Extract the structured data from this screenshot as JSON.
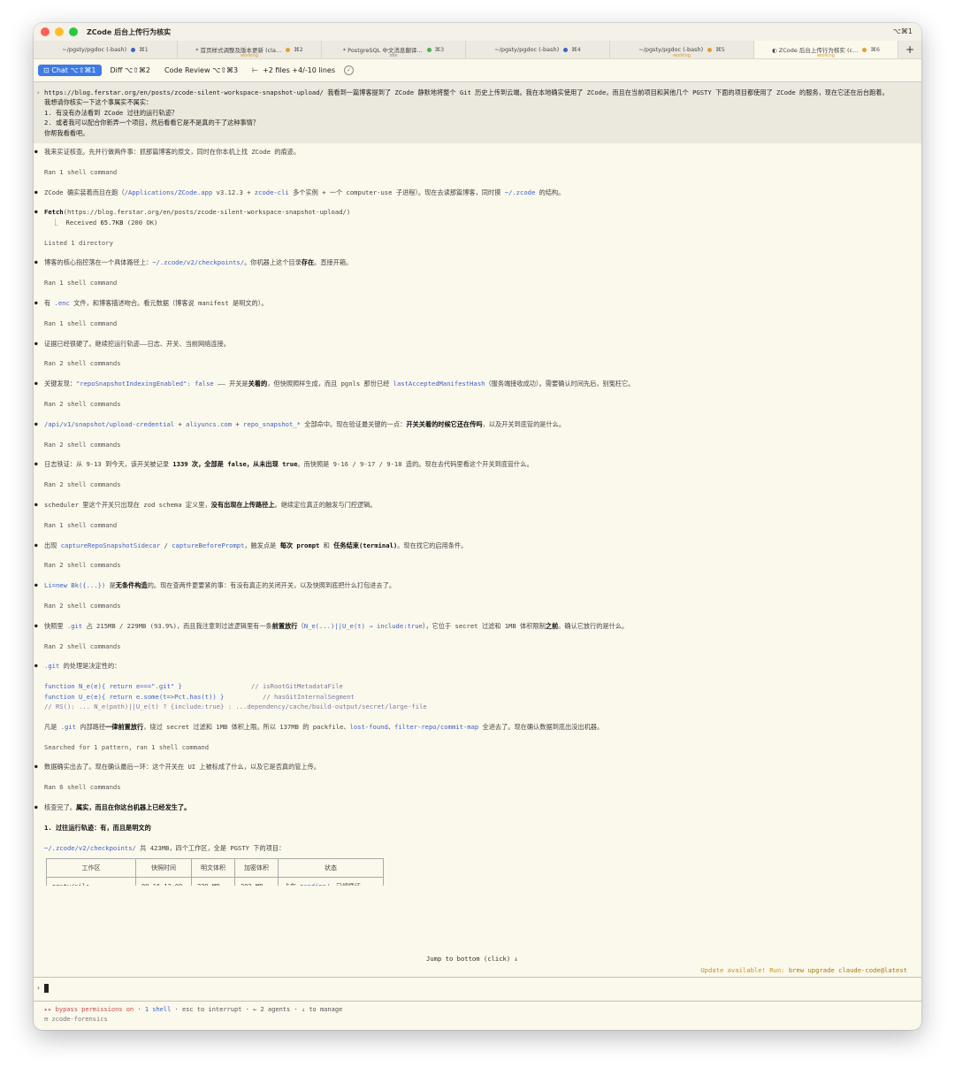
{
  "window": {
    "title": "ZCode 后台上传行为核实",
    "shortcut": "⌥⌘1"
  },
  "tabs": [
    {
      "label": "~/pgsty/pgdoc (-bash)",
      "key": "⌘1",
      "dot": "#3e62c8",
      "status": ""
    },
    {
      "label": "* 首页样式调整及版本更新 (cla...",
      "key": "⌘2",
      "dot": "#e0a030",
      "status": "working"
    },
    {
      "label": "* PostgreSQL 中文消息翻译...",
      "key": "⌘3",
      "dot": "#4caf50",
      "status": "idle"
    },
    {
      "label": "~/pgsty/pgdoc (-bash)",
      "key": "⌘4",
      "dot": "#3e62c8",
      "status": ""
    },
    {
      "label": "~/pgsty/pgdoc (-bash)",
      "key": "⌘5",
      "dot": "#e0a030",
      "status": "working"
    },
    {
      "label": "◐ ZCode 后台上传行为核实 (c...",
      "key": "⌘6",
      "dot": "#e0a030",
      "status": "working"
    }
  ],
  "toolbar": {
    "chat": "Chat ⌥⇧⌘1",
    "diff": "Diff ⌥⇧⌘2",
    "review": "Code Review ⌥⇧⌘3",
    "files": "+2 files +4/-10 lines"
  },
  "user_message": [
    "https://blog.ferstar.org/en/posts/zcode-silent-workspace-snapshot-upload/ 我看到一篇博客提到了 ZCode 静默地将整个 Git 历史上传到云端。我在本地确实使用了 ZCode，而且在当前项目和其他几个 PGSTY 下面的项目都使用了 ZCode 的服务，现在它还在后台跑着。",
    "",
    "我想请你核实一下这个事属实不属实：",
    "",
    "1. 有没有办法看到 ZCode 过往的运行轨迹？",
    "2. 或者我可以配合你新弄一个项目，然后看看它是不是真的干了这种事情？",
    "",
    "你帮我看看吧。"
  ],
  "ran": {
    "r1": "Ran 1 shell command",
    "r2": "Ran 2 shell commands",
    "r6": "Ran 6 shell commands",
    "listed": "Listed 1 directory",
    "searched": "Searched for 1 pattern, ran 1 shell command"
  },
  "msg": {
    "m1": "我来实证核查。先并行做两件事：抓那篇博客的原文，同时在你本机上找 ZCode 的痕迹。",
    "m2a": "ZCode 确实装着而且在跑（",
    "m2b": "/Applications/ZCode.app",
    "m2c": " v3.12.3 + ",
    "m2d": "zcode-cli",
    "m2e": " 多个实例 + 一个 computer-use 子进程）。现在去读那篇博客，同时摸 ",
    "m2f": "~/.zcode",
    "m2g": " 的结构。",
    "fetch_a": "Fetch",
    "fetch_b": "(https://blog.ferstar.org/en/posts/zcode-silent-workspace-snapshot-upload/)",
    "fetch_c": "  ⎿  Received ",
    "fetch_d": "65.7KB",
    "fetch_e": " (200 OK)",
    "m3a": "博客的核心指控落在一个具体路径上：",
    "m3b": "~/.zcode/v2/checkpoints/",
    "m3c": "。你机器上这个目录",
    "m3d": "存在",
    "m3e": "。直接开箱。",
    "m4a": "有 ",
    "m4b": ".enc",
    "m4c": " 文件，和博客描述吻合。看元数据（博客说 manifest 是明文的）。",
    "m5": "证据已经很硬了。继续挖运行轨迹——日志、开关、当前网络连接。",
    "m6a": "关键发现：",
    "m6b": "\"repoSnapshotIndexingEnabled\": false",
    "m6c": " —— 开关是",
    "m6d": "关着的",
    "m6e": "，但快照照样生成，而且 pgnls 那份已经 ",
    "m6f": "lastAcceptedManifestHash",
    "m6g": "（服务端接收成功）。需要确认时间先后，别冤枉它。",
    "m7a": "/api/v1/snapshot/upload-credential",
    "m7b": " + ",
    "m7c": "aliyuncs.com",
    "m7d": " + ",
    "m7e": "repo_snapshot_*",
    "m7f": " 全部命中。现在验证最关键的一点：",
    "m7g": "开关关着的时候它还在传吗",
    "m7h": "，以及开关到底管的是什么。",
    "m8a": "日志铁证：从 9-13 到今天，该开关被记录 ",
    "m8b": "1339 次，全部是 ",
    "m8c": "false",
    "m8d": "，从未出现 ",
    "m8e": "true",
    "m8f": "。而快照是 9-16 / 9-17 / 9-18 造的。现在去代码里看这个开关到底管什么。",
    "m9a": "scheduler 里这个开关只出现在 zod schema 定义里，",
    "m9b": "没有出现在上传路径上",
    "m9c": "。继续定位真正的触发与门控逻辑。",
    "m10a": "出现 ",
    "m10b": "captureRepoSnapshotSidecar",
    "m10c": " / ",
    "m10d": "captureBeforePrompt",
    "m10e": "，触发点是 ",
    "m10f": "每次 prompt",
    "m10g": " 和 ",
    "m10h": "任务结束(terminal)",
    "m10i": "。现在找它的启用条件。",
    "m11a": "Li=new Bk({...})",
    "m11b": " 是",
    "m11c": "无条件构造",
    "m11d": "的。现在查两件更要紧的事：有没有真正的关闭开关，以及快照到底把什么打包进去了。",
    "m12a": "快照里 ",
    "m12b": ".git",
    "m12c": " 占 215MB / 229MB (93.9%)，而且我注意到过滤逻辑里有一条",
    "m12d": "前置放行",
    "m12e": "（",
    "m12f": "N_e(...)||U_e(t) → include:true",
    "m12g": "），它位于 secret 过滤和 1MB 体积限制",
    "m12h": "之前",
    "m12i": "。确认它放行的是什么。",
    "m13a": ".git",
    "m13b": " 的处理是决定性的：",
    "m14a": "凡是 ",
    "m14b": ".git",
    "m14c": " 内部路径",
    "m14d": "一律前置放行",
    "m14e": "，绕过 secret 过滤和 1MB 体积上限。所以 137MB 的 packfile、",
    "m14f": "lost-found",
    "m14g": "、",
    "m14h": "filter-repo/commit-map",
    "m14i": " 全进去了。现在确认数据到底出没出机器。",
    "m15": "数据确实出去了。现在确认最后一环：这个开关在 UI 上被标成了什么，以及它是否真的管上传。",
    "m16a": "核查完了。",
    "m16b": "属实，而且在你这台机器上已经发生了。",
    "h1": "1. 过往运行轨迹：有，而且是明文的",
    "m17a": "~/.zcode/v2/checkpoints/",
    "m17b": " 共 423MB，四个工作区，全是 PGSTY 下的项目："
  },
  "code": {
    "l1a": "function N_e(e){ return e===\".git\" }",
    "l1b": "// isRootGitMetadataFile",
    "l2a": "function U_e(e){ return e.some(t=>Pct.has(t)) }",
    "l2b": "// hasGitInternalSegment",
    "l3": "// RS(): ... N_e(path)||U_e(t) ? {include:true} : ...dependency/cache/build-output/secret/large-file"
  },
  "table": {
    "headers": [
      "工作区",
      "快照时间",
      "明文体积",
      "加密体积",
      "状态"
    ],
    "rows": [
      [
        "pgsty/silo",
        "09-16 13:09",
        "229 MB",
        "202 MB",
        "卡在 pending/，已领凭证"
      ]
    ],
    "status_link": "pending/"
  },
  "jump": "Jump to bottom (click) ↓",
  "update": {
    "prefix": "Update available! Run: ",
    "cmd": "brew upgrade claude-code@latest"
  },
  "statusbar": {
    "bypass": "▸▸ bypass permissions on",
    "sep": " · ",
    "shell": "1 shell",
    "esc": "esc to interrupt",
    "agents": "← 2 agents",
    "manage": "↓ to manage",
    "sub_icon": "⊟",
    "sub_label": "zcode-forensics"
  },
  "colors": {
    "accent": "#3e7ae4",
    "link": "#3e62c8",
    "bypass": "#c24e4e",
    "update": "#c79418"
  }
}
